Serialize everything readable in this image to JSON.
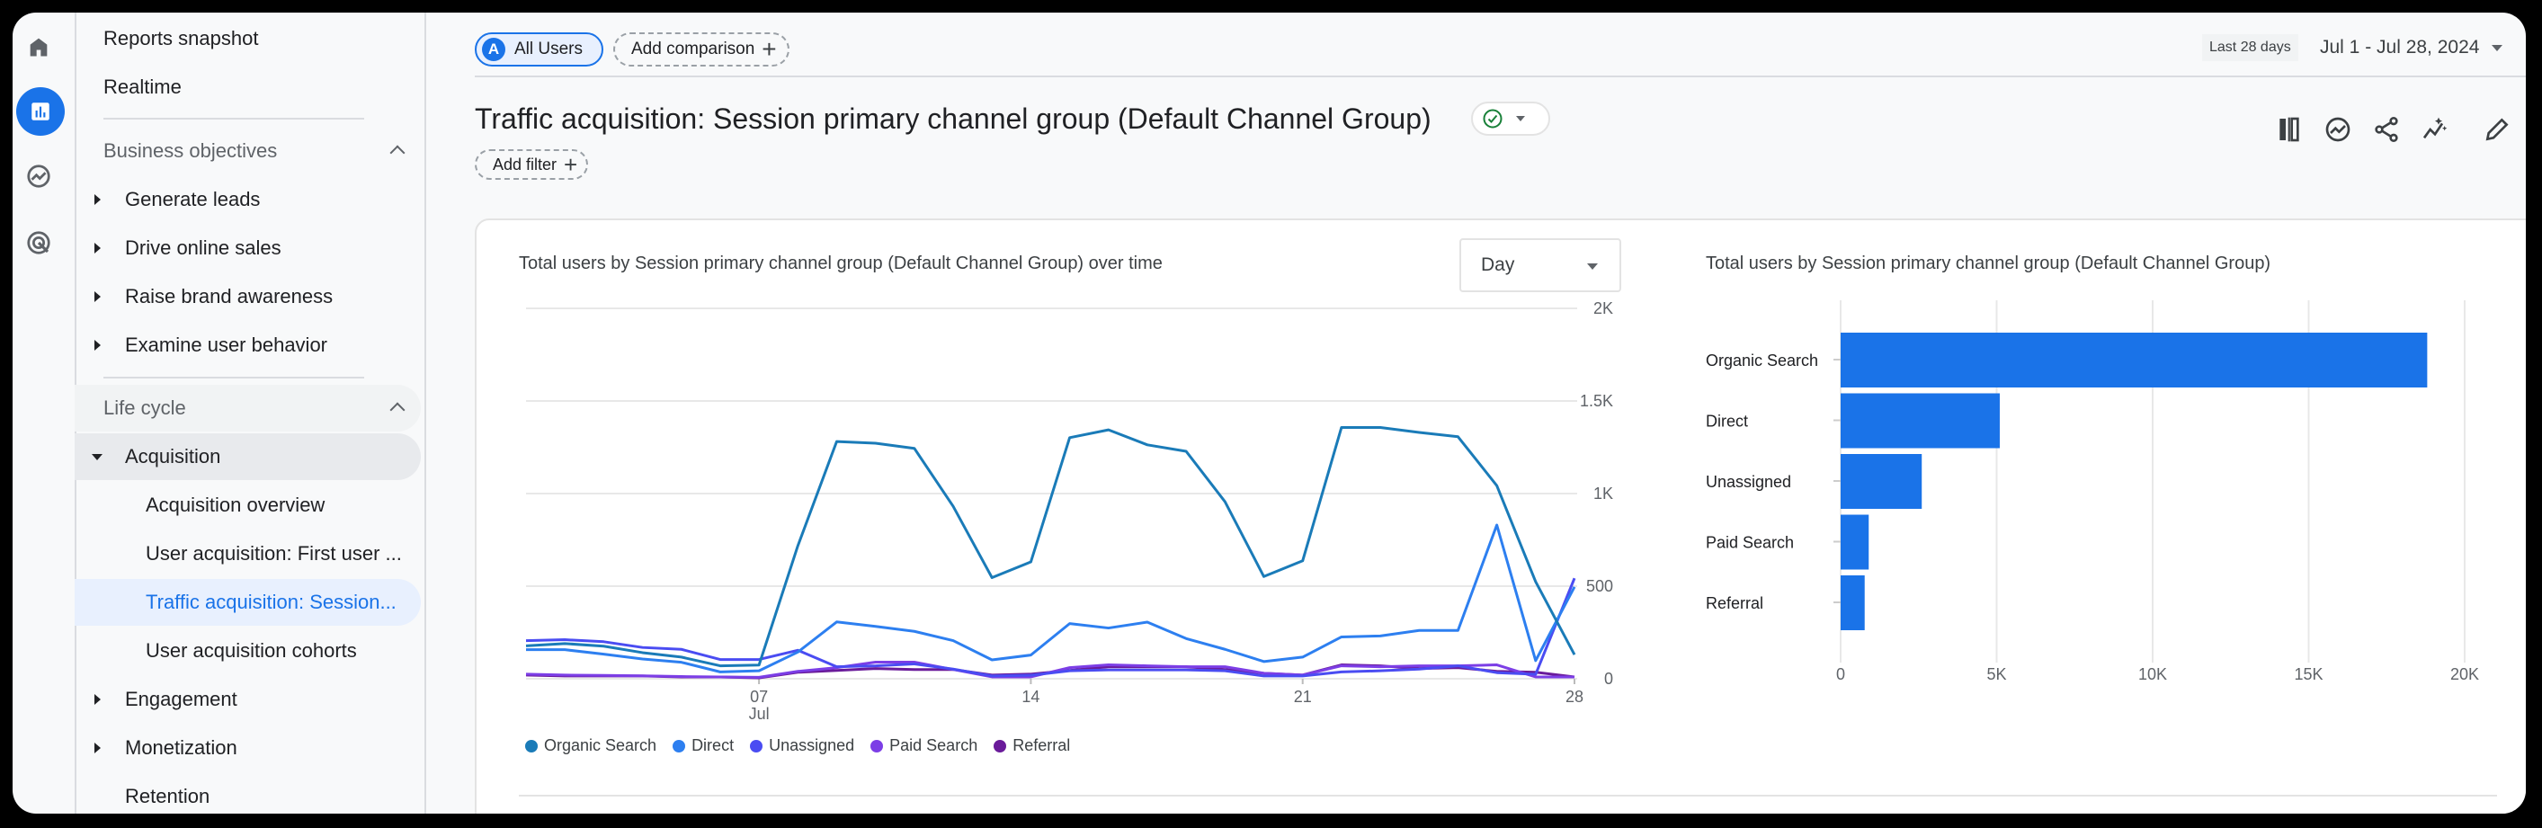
{
  "rail": {
    "icons": [
      "home-icon",
      "reports-icon",
      "explore-icon",
      "advertising-icon"
    ],
    "active": "reports-icon"
  },
  "sidebar": {
    "top_items": [
      {
        "label": "Reports snapshot"
      },
      {
        "label": "Realtime"
      }
    ],
    "business_objectives": {
      "label": "Business objectives",
      "expanded": true,
      "items": [
        {
          "label": "Generate leads"
        },
        {
          "label": "Drive online sales"
        },
        {
          "label": "Raise brand awareness"
        },
        {
          "label": "Examine user behavior"
        }
      ]
    },
    "life_cycle": {
      "label": "Life cycle",
      "expanded": true,
      "acquisition": {
        "label": "Acquisition",
        "expanded": true,
        "children": [
          {
            "label": "Acquisition overview"
          },
          {
            "label": "User acquisition: First user ..."
          },
          {
            "label": "Traffic acquisition: Session...",
            "selected": true
          },
          {
            "label": "User acquisition cohorts"
          }
        ]
      },
      "items": [
        {
          "label": "Engagement"
        },
        {
          "label": "Monetization"
        },
        {
          "label": "Retention"
        }
      ]
    }
  },
  "header": {
    "segment": {
      "badge": "A",
      "label": "All Users"
    },
    "add_comparison": "Add comparison",
    "date_range": {
      "preset": "Last 28 days",
      "value": "Jul 1 - Jul 28, 2024"
    },
    "title": "Traffic acquisition: Session primary channel group (Default Channel Group)",
    "add_filter": "Add filter",
    "toolbar_icons": [
      "compare-icon",
      "insights-icon",
      "share-icon",
      "sparkle-trend-icon",
      "edit-icon"
    ]
  },
  "colors": {
    "accent": "#1a73e8",
    "organic": "#1a7bb8",
    "direct": "#2d7ff0",
    "unassigned": "#4a4cf2",
    "paid": "#7c3ee6",
    "referral": "#6a1b9a",
    "bar": "#1a73e8",
    "status_ok": "#188038"
  },
  "granularity": {
    "selected": "Day"
  },
  "chart_data": [
    {
      "type": "line",
      "title": "Total users by Session primary channel group (Default Channel Group) over time",
      "x": [
        1,
        2,
        3,
        4,
        5,
        6,
        7,
        8,
        9,
        10,
        11,
        12,
        13,
        14,
        15,
        16,
        17,
        18,
        19,
        20,
        21,
        22,
        23,
        24,
        25,
        26,
        27,
        28
      ],
      "x_ticks": [
        {
          "day": 7,
          "label": "07",
          "sublabel": "Jul"
        },
        {
          "day": 14,
          "label": "14"
        },
        {
          "day": 21,
          "label": "21"
        },
        {
          "day": 28,
          "label": "28"
        }
      ],
      "y_ticks": [
        {
          "v": 0,
          "label": "0"
        },
        {
          "v": 500,
          "label": "500"
        },
        {
          "v": 1000,
          "label": "1K"
        },
        {
          "v": 1500,
          "label": "1.5K"
        },
        {
          "v": 2000,
          "label": "2K"
        }
      ],
      "ylim": [
        0,
        2000
      ],
      "grid": true,
      "legend": "bottom-left",
      "series": [
        {
          "name": "Organic Search",
          "color": "#1a7bb8",
          "values": [
            178,
            190,
            176,
            141,
            117,
            70,
            74,
            718,
            1281,
            1272,
            1244,
            931,
            546,
            631,
            1302,
            1344,
            1263,
            1228,
            956,
            552,
            637,
            1357,
            1357,
            1330,
            1307,
            1043,
            524,
            130
          ]
        },
        {
          "name": "Direct",
          "color": "#2d7ff0",
          "values": [
            157,
            157,
            133,
            107,
            89,
            37,
            43,
            144,
            307,
            283,
            256,
            206,
            102,
            128,
            298,
            274,
            306,
            217,
            159,
            93,
            117,
            226,
            231,
            261,
            261,
            830,
            98,
            496
          ]
        },
        {
          "name": "Unassigned",
          "color": "#4a4cf2",
          "values": [
            206,
            211,
            200,
            169,
            159,
            104,
            104,
            154,
            65,
            70,
            80,
            52,
            15,
            19,
            43,
            48,
            48,
            48,
            43,
            15,
            15,
            37,
            43,
            52,
            70,
            33,
            24,
            543
          ]
        },
        {
          "name": "Paid Search",
          "color": "#7c3ee6",
          "values": [
            25,
            20,
            18,
            16,
            12,
            10,
            8,
            40,
            60,
            90,
            90,
            50,
            10,
            10,
            60,
            75,
            70,
            65,
            65,
            30,
            20,
            70,
            65,
            70,
            70,
            75,
            10,
            10
          ]
        },
        {
          "name": "Referral",
          "color": "#6a1b9a",
          "values": [
            20,
            15,
            15,
            15,
            10,
            10,
            5,
            35,
            45,
            55,
            50,
            50,
            20,
            25,
            45,
            65,
            65,
            65,
            50,
            30,
            20,
            75,
            70,
            55,
            60,
            40,
            35,
            10
          ]
        }
      ]
    },
    {
      "type": "bar",
      "orientation": "horizontal",
      "title": "Total users by Session primary channel group (Default Channel Group)",
      "categories": [
        "Organic Search",
        "Direct",
        "Unassigned",
        "Paid Search",
        "Referral"
      ],
      "values": [
        18800,
        5100,
        2600,
        900,
        770
      ],
      "x_ticks": [
        {
          "v": 0,
          "label": "0"
        },
        {
          "v": 5000,
          "label": "5K"
        },
        {
          "v": 10000,
          "label": "10K"
        },
        {
          "v": 15000,
          "label": "15K"
        },
        {
          "v": 20000,
          "label": "20K"
        }
      ],
      "xlim": [
        0,
        20000
      ],
      "grid": true,
      "color": "#1a73e8"
    }
  ]
}
